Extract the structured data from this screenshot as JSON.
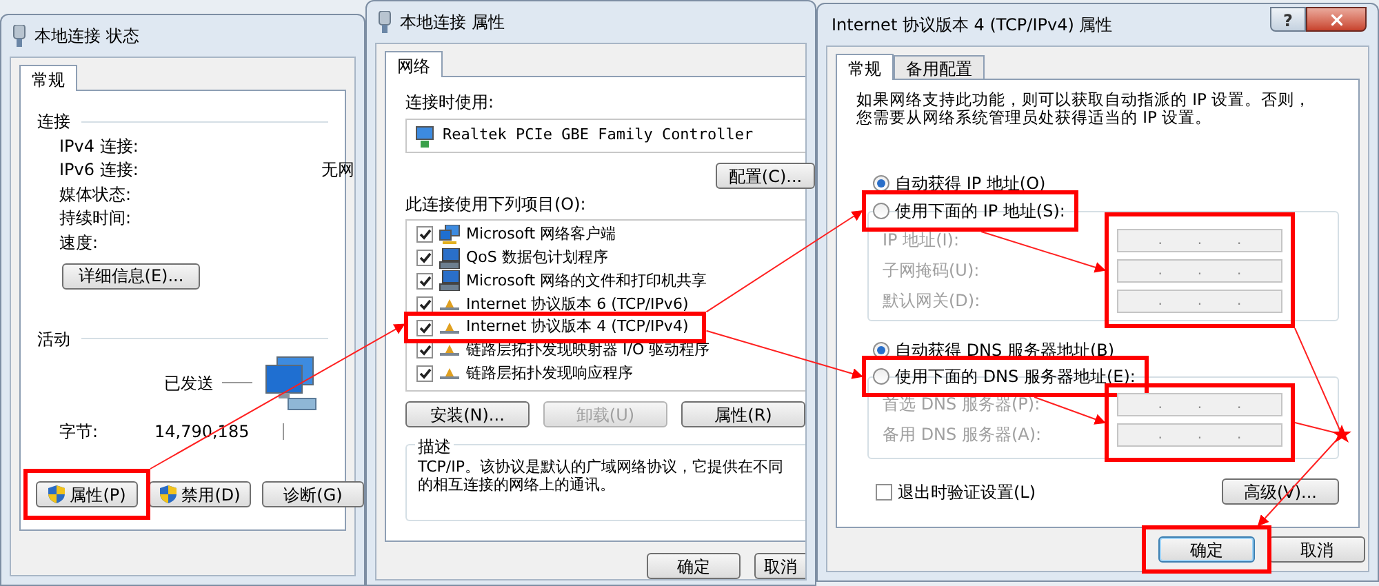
{
  "status_window": {
    "title": "本地连接 状态",
    "tabs": [
      {
        "label": "常规",
        "selected": true
      }
    ],
    "connection_heading": "连接",
    "connection_fields": [
      {
        "label": "IPv4 连接:"
      },
      {
        "label": "IPv6 连接:",
        "value": "无网"
      },
      {
        "label": "媒体状态:"
      },
      {
        "label": "持续时间:"
      },
      {
        "label": "速度:"
      }
    ],
    "details_button": "详细信息(E)...",
    "activity_heading": "活动",
    "sent_label": "已发送",
    "bytes_label": "字节:",
    "bytes_sent": "14,790,185",
    "buttons": [
      {
        "label": "属性(P)",
        "shield": true,
        "highlighted": true
      },
      {
        "label": "禁用(D)",
        "shield": true,
        "highlighted": false
      },
      {
        "label": "诊断(G)",
        "shield": false,
        "highlighted": false
      }
    ]
  },
  "properties_window": {
    "title": "本地连接 属性",
    "tabs": [
      {
        "label": "网络",
        "selected": true
      }
    ],
    "connect_using_label": "连接时使用:",
    "adapter": "Realtek PCIe GBE Family Controller",
    "configure_button": "配置(C)...",
    "items_label": "此连接使用下列项目(O):",
    "items": [
      {
        "label": "Microsoft 网络客户端",
        "checked": true,
        "kind": "client",
        "highlighted": false
      },
      {
        "label": "QoS 数据包计划程序",
        "checked": true,
        "kind": "service",
        "highlighted": false
      },
      {
        "label": "Microsoft 网络的文件和打印机共享",
        "checked": true,
        "kind": "service",
        "highlighted": false
      },
      {
        "label": "Internet 协议版本 6 (TCP/IPv6)",
        "checked": true,
        "kind": "protocol",
        "highlighted": false
      },
      {
        "label": "Internet 协议版本 4 (TCP/IPv4)",
        "checked": true,
        "kind": "protocol",
        "highlighted": true
      },
      {
        "label": "链路层拓扑发现映射器 I/O 驱动程序",
        "checked": true,
        "kind": "protocol",
        "highlighted": false
      },
      {
        "label": "链路层拓扑发现响应程序",
        "checked": true,
        "kind": "protocol",
        "highlighted": false
      }
    ],
    "buttons": [
      {
        "label": "安装(N)...",
        "disabled": false
      },
      {
        "label": "卸载(U)",
        "disabled": true
      },
      {
        "label": "属性(R)",
        "disabled": false
      }
    ],
    "description_heading": "描述",
    "description": "TCP/IP。该协议是默认的广域网络协议，它提供在不同的相互连接的网络上的通讯。",
    "dialog_buttons": [
      {
        "label": "确定"
      },
      {
        "label": "取消"
      }
    ]
  },
  "ipv4_window": {
    "title": "Internet 协议版本 4 (TCP/IPv4) 属性",
    "help_button": "?",
    "tabs": [
      {
        "label": "常规",
        "selected": true
      },
      {
        "label": "备用配置",
        "selected": false
      }
    ],
    "intro": "如果网络支持此功能，则可以获取自动指派的 IP 设置。否则，您需要从网络系统管理员处获得适当的 IP 设置。",
    "ip_options": [
      {
        "label": "自动获得 IP 地址(O)",
        "selected": true,
        "highlighted": false
      },
      {
        "label": "使用下面的 IP 地址(S):",
        "selected": false,
        "highlighted": true
      }
    ],
    "ip_fields_highlighted": true,
    "ip_fields": [
      {
        "label": "IP 地址(I):",
        "disabled": true,
        "separators": [
          ".",
          ".",
          "."
        ]
      },
      {
        "label": "子网掩码(U):",
        "disabled": true,
        "separators": [
          ".",
          ".",
          "."
        ]
      },
      {
        "label": "默认网关(D):",
        "disabled": true,
        "separators": [
          ".",
          ".",
          "."
        ]
      }
    ],
    "dns_options": [
      {
        "label": "自动获得 DNS 服务器地址(B)",
        "selected": true,
        "highlighted": false
      },
      {
        "label": "使用下面的 DNS 服务器地址(E):",
        "selected": false,
        "highlighted": true
      }
    ],
    "dns_fields_highlighted": true,
    "dns_fields": [
      {
        "label": "首选 DNS 服务器(P):",
        "disabled": true,
        "separators": [
          ".",
          ".",
          "."
        ]
      },
      {
        "label": "备用 DNS 服务器(A):",
        "disabled": true,
        "separators": [
          ".",
          ".",
          "."
        ]
      }
    ],
    "validate_checkbox": {
      "label": "退出时验证设置(L)",
      "checked": false
    },
    "advanced_button": "高级(V)...",
    "dialog_buttons": [
      {
        "label": "确定",
        "default": true,
        "highlighted": true
      },
      {
        "label": "取消",
        "default": false,
        "highlighted": false
      }
    ]
  }
}
